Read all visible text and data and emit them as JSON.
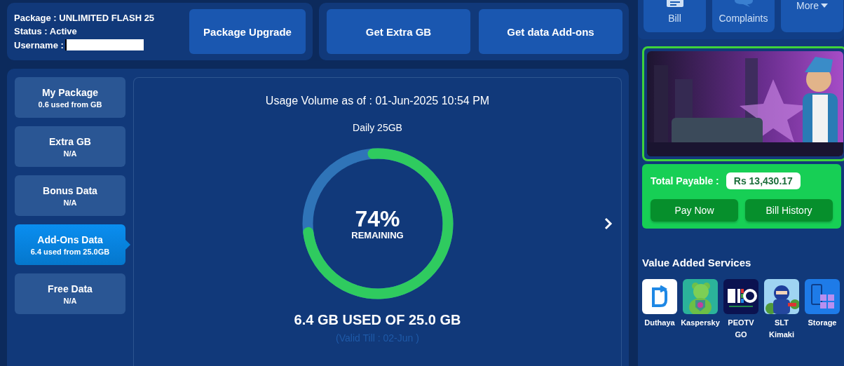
{
  "account": {
    "package": "Package : UNLIMITED FLASH 25",
    "status": "Status : Active",
    "username_label": "Username :"
  },
  "package_upgrade": "Package Upgrade",
  "data_actions": [
    "Get Extra GB",
    "Get data Add-ons"
  ],
  "quick_links": [
    {
      "label": "Bill",
      "kind": "bill"
    },
    {
      "label": "Complaints",
      "kind": "complaints"
    },
    {
      "label": "More",
      "kind": "more"
    }
  ],
  "data_types": [
    {
      "title": "My Package",
      "detail": "0.6 used from GB",
      "selected": false
    },
    {
      "title": "Extra GB",
      "detail": "N/A",
      "selected": false
    },
    {
      "title": "Bonus Data",
      "detail": "N/A",
      "selected": false
    },
    {
      "title": "Add-Ons Data",
      "detail": "6.4 used from 25.0GB",
      "selected": true
    },
    {
      "title": "Free Data",
      "detail": "N/A",
      "selected": false
    }
  ],
  "usage": {
    "heading": "Usage Volume as of : 01-Jun-2025 10:54 PM",
    "plan": "Daily 25GB",
    "level": 0.74,
    "percent": "74%",
    "percent_label": "REMAINING",
    "used": "6.4 GB USED OF 25.0 GB",
    "validity": "(Valid Till : 02-Jun )"
  },
  "billing": {
    "label": "Total Payable :",
    "amount": "Rs 13,430.17",
    "buttons": [
      "Pay Now",
      "Bill History"
    ]
  },
  "vas": {
    "title": "Value Added Services",
    "items": [
      {
        "name": "Duthaya",
        "kind": "duthaya"
      },
      {
        "name": "Kaspersky",
        "kind": "kaspersky"
      },
      {
        "name": "PEOTV GO",
        "kind": "peotv"
      },
      {
        "name": "SLT Kimaki",
        "kind": "kimaki"
      },
      {
        "name": "Storage",
        "kind": "storage"
      }
    ]
  }
}
